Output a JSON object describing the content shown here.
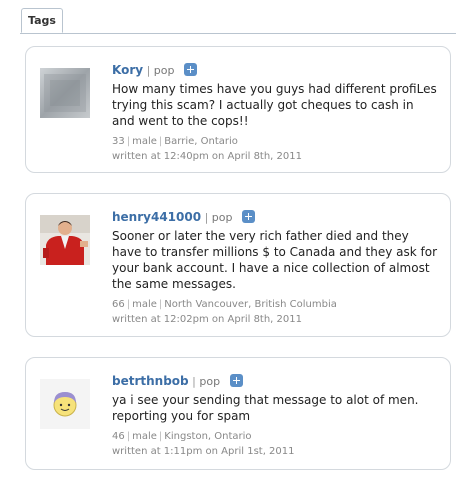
{
  "tabs": [
    {
      "label": "Tags"
    }
  ],
  "comments": [
    {
      "username": "Kory",
      "relation": "pop",
      "message": "How many times have you guys had different profiLes trying this scam? I actually got cheques to cash in and went to the cops!!",
      "age": "33",
      "gender": "male",
      "location": "Barrie, Ontario",
      "written_at": "written at 12:40pm on April 8th, 2011"
    },
    {
      "username": "henry441000",
      "relation": "pop",
      "message": "Sooner or later the very rich father died and they have to transfer millions $ to Canada and they ask for your bank account. I have a nice collection of almost the same messages.",
      "age": "66",
      "gender": "male",
      "location": "North Vancouver, British Columbia",
      "written_at": "written at 12:02pm on April 8th, 2011"
    },
    {
      "username": "betrthnbob",
      "relation": "pop",
      "message": "ya i see your sending that message to alot of men. reporting you for spam",
      "age": "46",
      "gender": "male",
      "location": "Kingston, Ontario",
      "written_at": "written at 1:11pm on April 1st, 2011"
    }
  ]
}
